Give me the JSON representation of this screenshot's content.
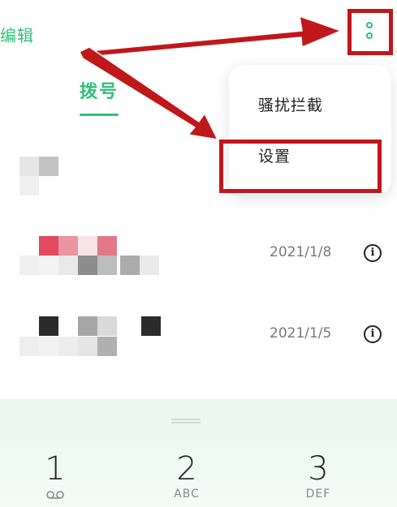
{
  "header": {
    "edit_label": "编辑",
    "dial_tab": "拨号"
  },
  "menu": {
    "items": [
      {
        "label": "骚扰拦截"
      },
      {
        "label": "设置"
      }
    ]
  },
  "call_log": [
    {
      "date": ""
    },
    {
      "date": "2021/1/8"
    },
    {
      "date": "2021/1/5"
    }
  ],
  "keypad": {
    "keys": [
      {
        "digit": "1",
        "letters": "voicemail-icon"
      },
      {
        "digit": "2",
        "letters": "ABC"
      },
      {
        "digit": "3",
        "letters": "DEF"
      }
    ]
  },
  "colors": {
    "accent": "#2fbf7a",
    "annotation": "#c0171b"
  }
}
